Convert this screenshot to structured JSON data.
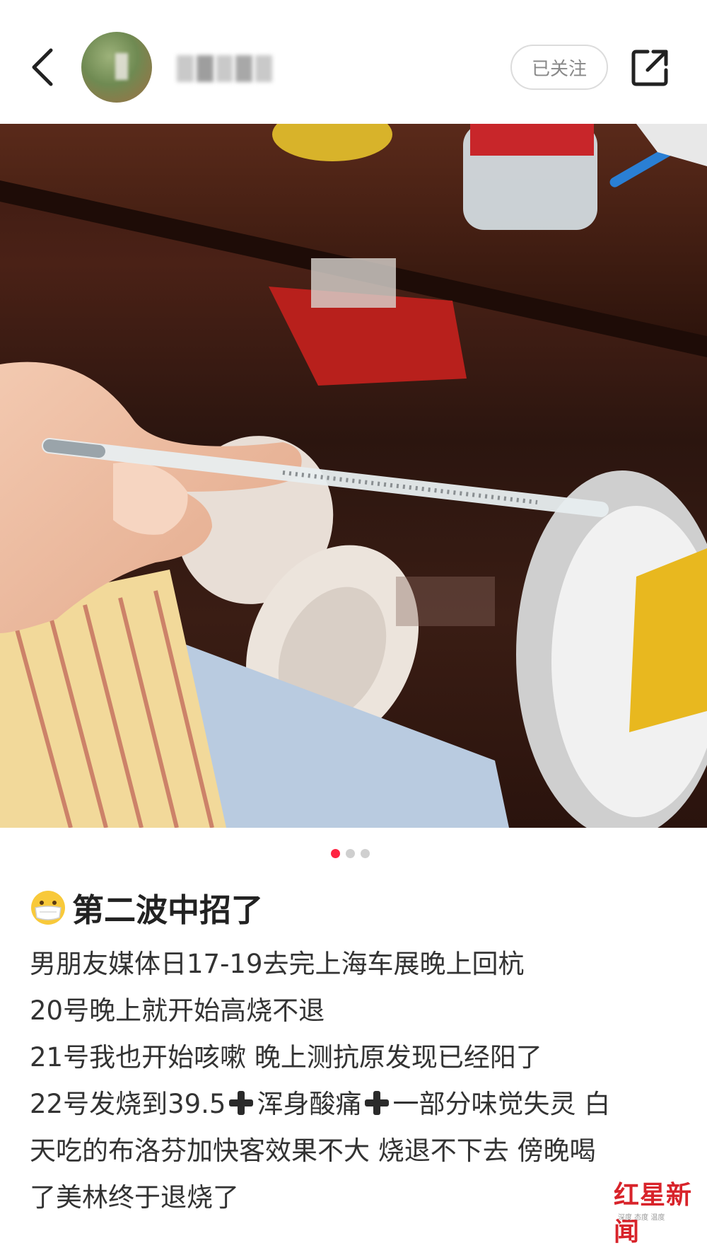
{
  "header": {
    "follow_label": "已关注"
  },
  "carousel": {
    "total": 3,
    "current": 1
  },
  "post": {
    "title": "第二波中招了",
    "lines": [
      "男朋友媒体日17-19去完上海车展晚上回杭",
      "20号晚上就开始高烧不退",
      "21号我也开始咳嗽 晚上测抗原发现已经阳了"
    ],
    "line4_a": "22号发烧到39.5",
    "line4_b": "浑身酸痛",
    "line4_c": "一部分味觉失灵 白",
    "line5": "天吃的布洛芬加快客效果不大 烧退不下去 傍晚喝",
    "line6": "了美林终于退烧了"
  },
  "watermark": {
    "logo_text": "红星新闻",
    "sub_text": "深度 态度 温度"
  },
  "colors": {
    "accent": "#ff2442",
    "watermark": "#d8232a"
  },
  "icons": [
    "back-arrow-icon",
    "share-icon",
    "mask-face-emoji-icon",
    "plus-icon"
  ]
}
